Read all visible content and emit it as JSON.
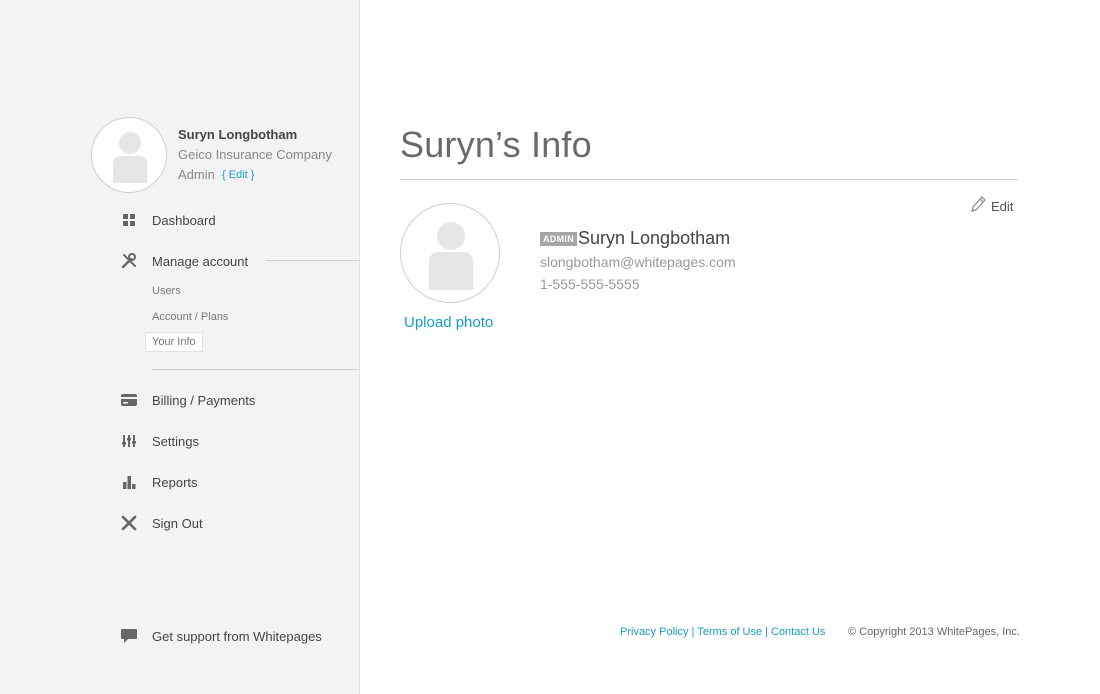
{
  "profile": {
    "name": "Suryn Longbotham",
    "company": "Geico Insurance Company",
    "role": "Admin",
    "edit_label": "{ Edit }"
  },
  "sidebar": {
    "items": [
      {
        "label": "Dashboard",
        "icon": "dashboard-icon"
      },
      {
        "label": "Manage account",
        "icon": "tools-icon"
      },
      {
        "label": "Billing / Payments",
        "icon": "credit-card-icon"
      },
      {
        "label": "Settings",
        "icon": "sliders-icon"
      },
      {
        "label": "Reports",
        "icon": "bar-chart-icon"
      },
      {
        "label": "Sign Out",
        "icon": "close-icon"
      }
    ],
    "sub_items": [
      {
        "label": "Users"
      },
      {
        "label": "Account / Plans"
      },
      {
        "label": "Your Info",
        "active": true
      }
    ],
    "support_label": "Get support from Whitepages"
  },
  "main": {
    "title": "Suryn’s Info",
    "edit_label": "Edit",
    "upload_label": "Upload photo",
    "badge": "ADMIN",
    "user_name": "Suryn Longbotham",
    "email": "slongbotham@whitepages.com",
    "phone": "1-555-555-5555"
  },
  "footer": {
    "links": [
      "Privacy Policy",
      "Terms of Use",
      "Contact Us"
    ],
    "separator": "|",
    "copyright": "© Copyright 2013 WhitePages, Inc."
  },
  "colors": {
    "accent": "#1a9bc7",
    "sidebar_bg": "#f3f3f3",
    "badge_bg": "#a6a6a6"
  }
}
